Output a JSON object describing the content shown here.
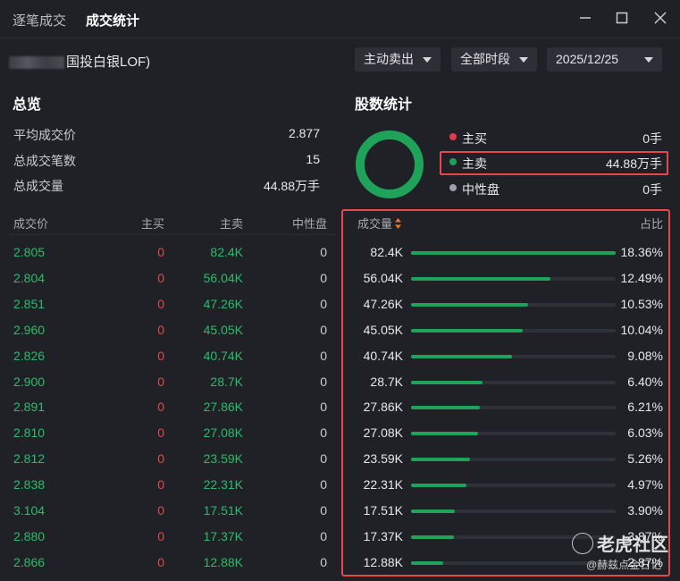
{
  "tabs": [
    {
      "label": "逐笔成交",
      "active": false
    },
    {
      "label": "成交统计",
      "active": true
    }
  ],
  "security_name": "国投白银LOF)",
  "filters": {
    "direction": "主动卖出",
    "period": "全部时段",
    "date": "2025/12/25"
  },
  "overview": {
    "title": "总览",
    "items": [
      {
        "label": "平均成交价",
        "value": "2.877"
      },
      {
        "label": "总成交笔数",
        "value": "15"
      },
      {
        "label": "总成交量",
        "value": "44.88万手"
      }
    ]
  },
  "share_stats": {
    "title": "股数统计",
    "legend": [
      {
        "label": "主买",
        "value": "0手",
        "color": "#e03c4b"
      },
      {
        "label": "主卖",
        "value": "44.88万手",
        "color": "#1fa35b"
      },
      {
        "label": "中性盘",
        "value": "0手",
        "color": "#9aa0a8"
      }
    ]
  },
  "table": {
    "headers": {
      "price": "成交价",
      "buy": "主买",
      "sell": "主卖",
      "neutral": "中性盘",
      "volume": "成交量",
      "ratio": "占比"
    },
    "rows": [
      {
        "price": "2.805",
        "buy": "0",
        "sell": "82.4K",
        "neutral": "0",
        "volume": "82.4K",
        "ratio": "18.36%",
        "bar": 1.0
      },
      {
        "price": "2.804",
        "buy": "0",
        "sell": "56.04K",
        "neutral": "0",
        "volume": "56.04K",
        "ratio": "12.49%",
        "bar": 0.68
      },
      {
        "price": "2.851",
        "buy": "0",
        "sell": "47.26K",
        "neutral": "0",
        "volume": "47.26K",
        "ratio": "10.53%",
        "bar": 0.573
      },
      {
        "price": "2.960",
        "buy": "0",
        "sell": "45.05K",
        "neutral": "0",
        "volume": "45.05K",
        "ratio": "10.04%",
        "bar": 0.547
      },
      {
        "price": "2.826",
        "buy": "0",
        "sell": "40.74K",
        "neutral": "0",
        "volume": "40.74K",
        "ratio": "9.08%",
        "bar": 0.494
      },
      {
        "price": "2.900",
        "buy": "0",
        "sell": "28.7K",
        "neutral": "0",
        "volume": "28.7K",
        "ratio": "6.40%",
        "bar": 0.348
      },
      {
        "price": "2.891",
        "buy": "0",
        "sell": "27.86K",
        "neutral": "0",
        "volume": "27.86K",
        "ratio": "6.21%",
        "bar": 0.338
      },
      {
        "price": "2.810",
        "buy": "0",
        "sell": "27.08K",
        "neutral": "0",
        "volume": "27.08K",
        "ratio": "6.03%",
        "bar": 0.329
      },
      {
        "price": "2.812",
        "buy": "0",
        "sell": "23.59K",
        "neutral": "0",
        "volume": "23.59K",
        "ratio": "5.26%",
        "bar": 0.286
      },
      {
        "price": "2.838",
        "buy": "0",
        "sell": "22.31K",
        "neutral": "0",
        "volume": "22.31K",
        "ratio": "4.97%",
        "bar": 0.271
      },
      {
        "price": "3.104",
        "buy": "0",
        "sell": "17.51K",
        "neutral": "0",
        "volume": "17.51K",
        "ratio": "3.90%",
        "bar": 0.212
      },
      {
        "price": "2.880",
        "buy": "0",
        "sell": "17.37K",
        "neutral": "0",
        "volume": "17.37K",
        "ratio": "3.87%",
        "bar": 0.211
      },
      {
        "price": "2.866",
        "buy": "0",
        "sell": "12.88K",
        "neutral": "0",
        "volume": "12.88K",
        "ratio": "2.87%",
        "bar": 0.156
      }
    ]
  },
  "watermark": {
    "logo_icon": "tiger-logo-icon",
    "title": "老虎社区",
    "subtitle": "@赫兹点金日记"
  }
}
